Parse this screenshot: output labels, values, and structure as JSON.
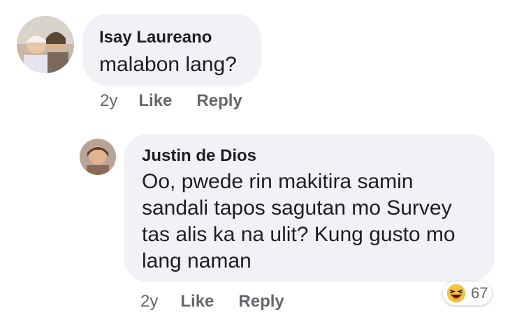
{
  "comments": [
    {
      "author": "Isay Laureano",
      "text": "malabon lang?",
      "time": "2y",
      "like_label": "Like",
      "reply_label": "Reply"
    },
    {
      "author": "Justin de Dios",
      "text": "Oo, pwede rin makitira samin sandali tapos sagutan mo Survey tas alis ka na ulit? Kung gusto mo lang naman",
      "time": "2y",
      "like_label": "Like",
      "reply_label": "Reply",
      "reaction": {
        "icon": "laughing-emoji-icon",
        "count": "67"
      }
    }
  ]
}
